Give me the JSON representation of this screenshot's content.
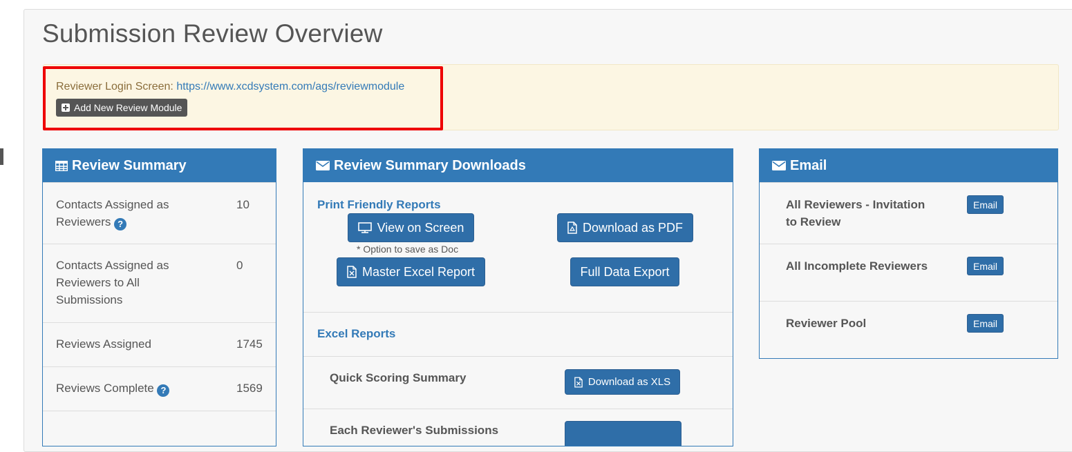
{
  "page": {
    "title": "Submission Review Overview"
  },
  "alert": {
    "login_label": "Reviewer Login Screen:",
    "login_url": "https://www.xcdsystem.com/ags/reviewmodule",
    "add_button": "Add New Review Module"
  },
  "summary": {
    "title": "Review Summary",
    "rows": [
      {
        "label": "Contacts Assigned as Reviewers",
        "value": "10",
        "help": true
      },
      {
        "label": "Contacts Assigned as Reviewers to All Submissions",
        "value": "0",
        "help": false
      },
      {
        "label": "Reviews Assigned",
        "value": "1745",
        "help": false
      },
      {
        "label": "Reviews Complete",
        "value": "1569",
        "help": true
      }
    ]
  },
  "downloads": {
    "title": "Review Summary Downloads",
    "print_heading": "Print Friendly Reports",
    "view_screen": "View on Screen",
    "download_pdf": "Download as PDF",
    "save_note": "* Option to save as Doc",
    "master_excel": "Master Excel Report",
    "full_export": "Full Data Export",
    "excel_heading": "Excel Reports",
    "quick_label": "Quick Scoring Summary",
    "download_xls": "Download as XLS",
    "next_label": "Each Reviewer's Submissions"
  },
  "email": {
    "title": "Email",
    "rows": [
      {
        "label": "All Reviewers - Invitation to Review",
        "button": "Email"
      },
      {
        "label": "All Incomplete Reviewers",
        "button": "Email"
      },
      {
        "label": "Reviewer Pool",
        "button": "Email"
      }
    ]
  },
  "icons": [
    "plus-square-icon",
    "table-icon",
    "envelope-icon",
    "monitor-icon",
    "pdf-file-icon",
    "excel-file-icon",
    "help-icon"
  ],
  "colors": {
    "primary": "#337ab7",
    "highlight": "#ee0000",
    "alert_bg": "#fcf6e3"
  }
}
